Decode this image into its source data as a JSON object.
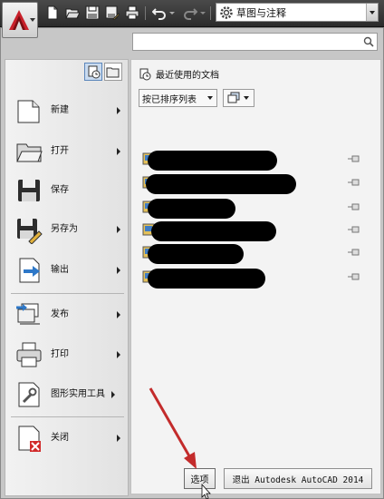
{
  "qat": {
    "icons": [
      "new-icon",
      "open-icon",
      "save-icon",
      "saveas-icon",
      "print-icon",
      "undo-icon",
      "redo-icon"
    ],
    "workspace": "草图与注释"
  },
  "search": {
    "placeholder": ""
  },
  "left_menu": {
    "items": [
      {
        "label": "新建",
        "icon": "new-doc-icon",
        "has_submenu": true
      },
      {
        "label": "打开",
        "icon": "open-folder-icon",
        "has_submenu": true
      },
      {
        "label": "保存",
        "icon": "floppy-icon",
        "has_submenu": false
      },
      {
        "label": "另存为",
        "icon": "floppy-pen-icon",
        "has_submenu": true
      },
      {
        "label": "输出",
        "icon": "export-icon",
        "has_submenu": true
      },
      {
        "label": "发布",
        "icon": "publish-icon",
        "has_submenu": true
      },
      {
        "label": "打印",
        "icon": "printer-icon",
        "has_submenu": true
      },
      {
        "label": "图形实用工具",
        "icon": "wrench-doc-icon",
        "has_submenu": true
      },
      {
        "label": "关闭",
        "icon": "close-doc-icon",
        "has_submenu": true
      }
    ]
  },
  "recent": {
    "header": "最近使用的文档",
    "sort_label": "按已排序列表",
    "files": [
      {
        "name": "",
        "redacted": true,
        "pinned": false
      },
      {
        "name": "",
        "redacted": true,
        "pinned": false
      },
      {
        "name": "",
        "redacted": true,
        "pinned": false
      },
      {
        "name": "",
        "redacted": true,
        "pinned": false
      },
      {
        "name": "",
        "redacted": true,
        "pinned": false
      },
      {
        "name": "",
        "redacted": true,
        "pinned": false
      }
    ]
  },
  "footer": {
    "options_label": "选项",
    "exit_label": "退出 Autodesk AutoCAD 2014"
  },
  "colors": {
    "accent": "#c8202a",
    "pointer_arrow": "#c32b2b",
    "selected_toggle": "#c9dbf0"
  }
}
